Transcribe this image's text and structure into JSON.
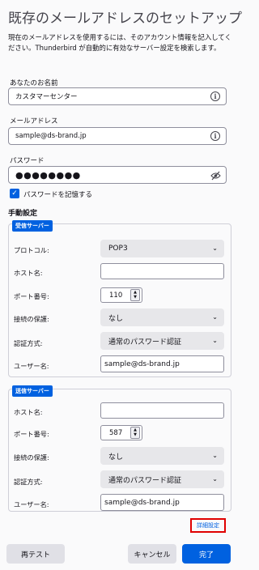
{
  "header": {
    "title": "既存のメールアドレスのセットアップ",
    "description": "現在のメールアドレスを使用するには、そのアカウント情報を記入してください。Thunderbird が自動的に有効なサーバー設定を検索します。"
  },
  "account": {
    "name_label": "あなたのお名前",
    "name_value": "カスタマーセンター",
    "email_label": "メールアドレス",
    "email_value": "sample@ds-brand.jp",
    "password_label": "パスワード",
    "password_value": "●●●●●●●●",
    "remember_label": "パスワードを記憶する"
  },
  "manual": {
    "title": "手動設定",
    "incoming": {
      "legend": "受信サーバー",
      "protocol_label": "プロトコル:",
      "protocol_value": "POP3",
      "host_label": "ホスト名:",
      "host_value": "",
      "port_label": "ポート番号:",
      "port_value": "110",
      "security_label": "接続の保護:",
      "security_value": "なし",
      "auth_label": "認証方式:",
      "auth_value": "通常のパスワード認証",
      "user_label": "ユーザー名:",
      "user_value": "sample@ds-brand.jp"
    },
    "outgoing": {
      "legend": "送信サーバー",
      "host_label": "ホスト名:",
      "host_value": "",
      "port_label": "ポート番号:",
      "port_value": "587",
      "security_label": "接続の保護:",
      "security_value": "なし",
      "auth_label": "認証方式:",
      "auth_value": "通常のパスワード認証",
      "user_label": "ユーザー名:",
      "user_value": "sample@ds-brand.jp"
    },
    "advanced_label": "詳細設定"
  },
  "footer": {
    "retest_label": "再テスト",
    "cancel_label": "キャンセル",
    "done_label": "完了"
  },
  "colors": {
    "accent": "#0061e0",
    "highlight": "#e00000"
  },
  "icons": [
    "info-icon",
    "eye-off-icon",
    "checkmark-icon",
    "chevron-down-icon",
    "spin-up-icon",
    "spin-down-icon"
  ]
}
